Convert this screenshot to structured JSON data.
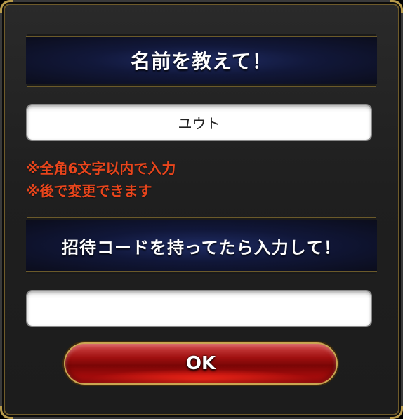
{
  "name_section": {
    "title": "名前を教えて！",
    "input_value": "ユウト",
    "notes": [
      "※全角6文字以内で入力",
      "※後で変更できます"
    ]
  },
  "invite_section": {
    "title": "招待コードを持ってたら入力して！",
    "input_value": ""
  },
  "ok_button": {
    "label": "OK"
  },
  "colors": {
    "note_text": "#e8451c",
    "banner": "#0f1a4a",
    "button": "#c00f0f",
    "frame_gold": "#b89b4b"
  }
}
